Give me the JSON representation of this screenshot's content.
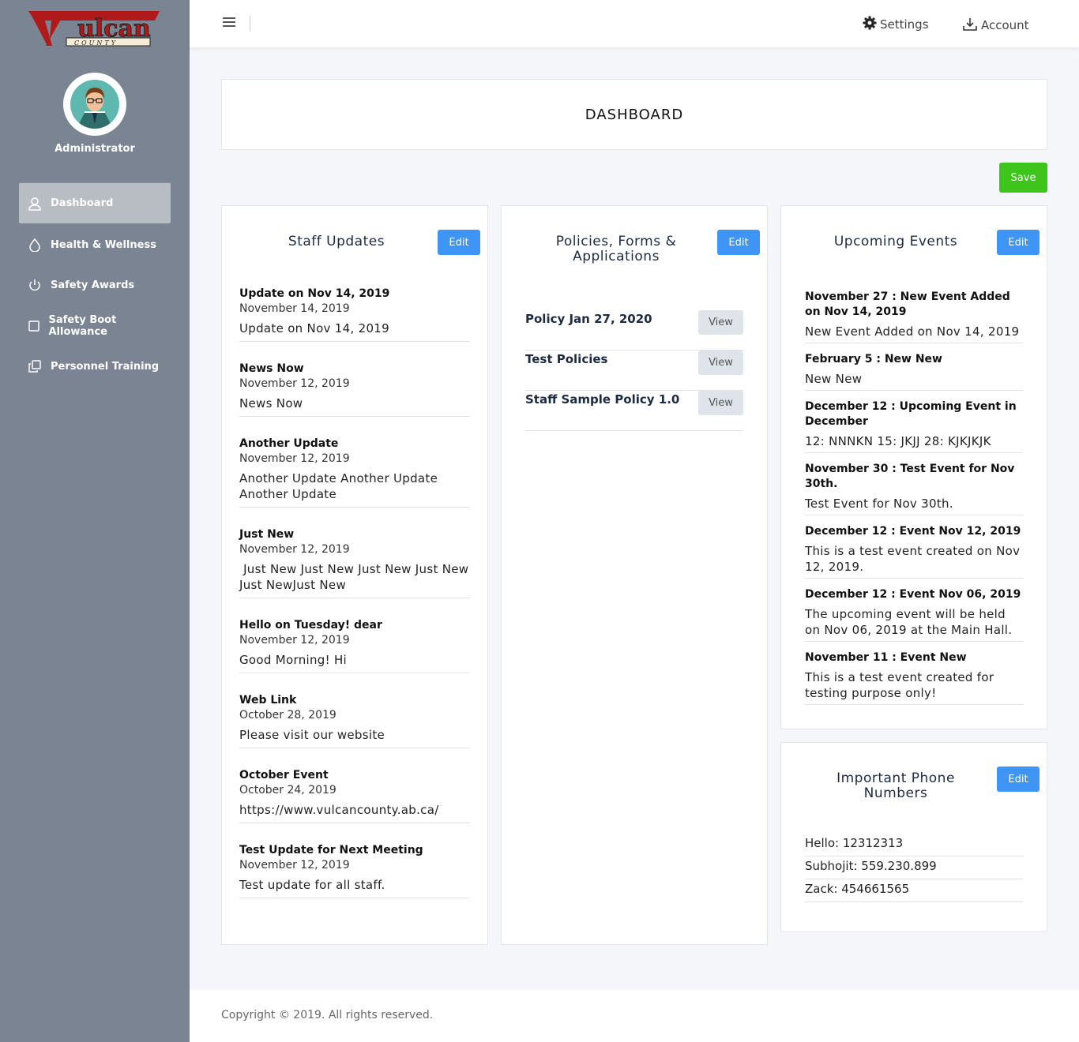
{
  "sidebar": {
    "logo_text": "Vulcan",
    "logo_subtext": "COUNTY",
    "user_name": "Administrator",
    "nav": [
      {
        "label": "Dashboard",
        "icon": "user-icon"
      },
      {
        "label": "Health & Wellness",
        "icon": "drop-icon"
      },
      {
        "label": "Safety Awards",
        "icon": "power-icon"
      },
      {
        "label": "Safety Boot Allowance",
        "icon": "square-icon"
      },
      {
        "label": "Personnel Training",
        "icon": "copy-icon"
      }
    ]
  },
  "topbar": {
    "settings_label": "Settings",
    "account_label": "Account"
  },
  "main": {
    "title": "DASHBOARD",
    "save_label": "Save",
    "edit_label": "Edit",
    "view_label": "View"
  },
  "staff_updates": {
    "title": "Staff Updates",
    "items": [
      {
        "title": "Update on Nov 14, 2019",
        "date": "November 14, 2019",
        "body": "Update on Nov 14, 2019"
      },
      {
        "title": "News Now",
        "date": "November 12, 2019",
        "body": "News Now"
      },
      {
        "title": "Another Update",
        "date": "November 12, 2019",
        "body": "Another Update Another Update Another Update"
      },
      {
        "title": "Just New",
        "date": "November 12, 2019",
        "body": " Just New Just New Just New Just New Just NewJust New"
      },
      {
        "title": "Hello on Tuesday! dear",
        "date": "November 12, 2019",
        "body": "Good Morning! Hi"
      },
      {
        "title": "Web Link",
        "date": "October 28, 2019",
        "body": "Please visit our website"
      },
      {
        "title": "October Event",
        "date": "October 24, 2019",
        "body": "https://www.vulcancounty.ab.ca/"
      },
      {
        "title": "Test Update for Next Meeting",
        "date": "November 12, 2019",
        "body": "Test update for all staff."
      }
    ]
  },
  "policies": {
    "title": "Policies, Forms & Applications",
    "items": [
      {
        "name": "Policy Jan 27, 2020"
      },
      {
        "name": "Test Policies"
      },
      {
        "name": "Staff Sample Policy 1.0"
      }
    ]
  },
  "events": {
    "title": "Upcoming Events",
    "items": [
      {
        "title": "November 27 : New Event Added on Nov 14, 2019",
        "body": "New Event Added on Nov 14, 2019"
      },
      {
        "title": "February 5 : New New",
        "body": "New New"
      },
      {
        "title": "December 12 : Upcoming Event in December",
        "body": "12: NNNKN 15: JKJJ 28: KJKJKJK"
      },
      {
        "title": "November 30 : Test Event for Nov 30th.",
        "body": "Test Event for Nov 30th."
      },
      {
        "title": "December 12 : Event Nov 12, 2019",
        "body": "This is a test event created on Nov 12, 2019."
      },
      {
        "title": "December 12 : Event Nov 06, 2019",
        "body": "The upcoming event will be held on Nov 06, 2019 at the Main Hall."
      },
      {
        "title": "November 11 : Event New",
        "body": "This is a test event created for testing purpose only!"
      }
    ]
  },
  "phones": {
    "title": "Important Phone Numbers",
    "items": [
      "Hello: 12312313",
      "Subhojit: 559.230.899",
      "Zack: 454661565"
    ]
  },
  "footer": {
    "copyright": "Copyright © 2019. All rights reserved."
  },
  "colors": {
    "sidebar_bg": "#7a8492",
    "save_green": "#3ec51b",
    "edit_blue": "#3e95f5",
    "logo_red": "#b11a1a"
  }
}
